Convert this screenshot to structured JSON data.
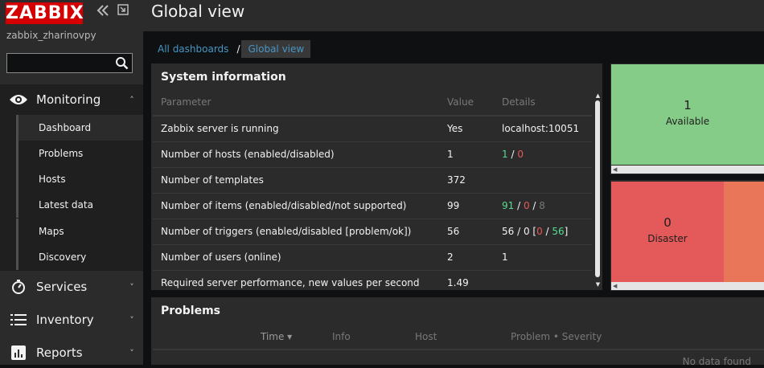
{
  "sidebar": {
    "logo": "ZABBIX",
    "server_name": "zabbix_zharinovpy",
    "search": {
      "value": "",
      "placeholder": ""
    },
    "sections": [
      {
        "label": "Monitoring",
        "icon": "eye-icon",
        "expanded": true
      },
      {
        "label": "Services",
        "icon": "stopwatch-icon",
        "expanded": false
      },
      {
        "label": "Inventory",
        "icon": "list-icon",
        "expanded": false
      },
      {
        "label": "Reports",
        "icon": "bar-chart-icon",
        "expanded": false
      }
    ],
    "monitoring_items": [
      "Dashboard",
      "Problems",
      "Hosts",
      "Latest data",
      "Maps",
      "Discovery"
    ],
    "selected_item": "Dashboard"
  },
  "header": {
    "title": "Global view"
  },
  "breadcrumb": {
    "root": "All dashboards",
    "separator": "/",
    "current": "Global view"
  },
  "system_info": {
    "title": "System information",
    "columns": [
      "Parameter",
      "Value",
      "Details"
    ],
    "rows": [
      {
        "param": "Zabbix server is running",
        "value": "Yes",
        "details": "localhost:10051"
      },
      {
        "param": "Number of hosts (enabled/disabled)",
        "value": "1",
        "details": {
          "a": "1",
          "sep1": " / ",
          "b": "0"
        }
      },
      {
        "param": "Number of templates",
        "value": "372",
        "details": ""
      },
      {
        "param": "Number of items (enabled/disabled/not supported)",
        "value": "99",
        "details": {
          "a": "91",
          "sep1": " / ",
          "b": "0",
          "sep2": " / ",
          "c": "8"
        }
      },
      {
        "param": "Number of triggers (enabled/disabled [problem/ok])",
        "value": "56",
        "details": {
          "pre": "56 / 0 [",
          "a": "0",
          "sep1": " / ",
          "b": "56",
          "post": "]"
        }
      },
      {
        "param": "Number of users (online)",
        "value": "2",
        "details": "1"
      },
      {
        "param": "Required server performance, new values per second",
        "value": "1.49",
        "details": ""
      }
    ]
  },
  "host_availability": {
    "count": "1",
    "label": "Available"
  },
  "problems_by_severity": {
    "count": "0",
    "label": "Disaster"
  },
  "problems": {
    "title": "Problems",
    "columns": [
      "Time ▾",
      "Info",
      "Host",
      "Problem • Severity"
    ],
    "empty_text": "No data found"
  },
  "colors": {
    "brand": "#d40000",
    "link": "#4796c4",
    "ok_green": "#59db8f",
    "problem_red": "#e45959",
    "available": "#86cc89",
    "disaster": "#e45959",
    "high": "#e97659"
  }
}
